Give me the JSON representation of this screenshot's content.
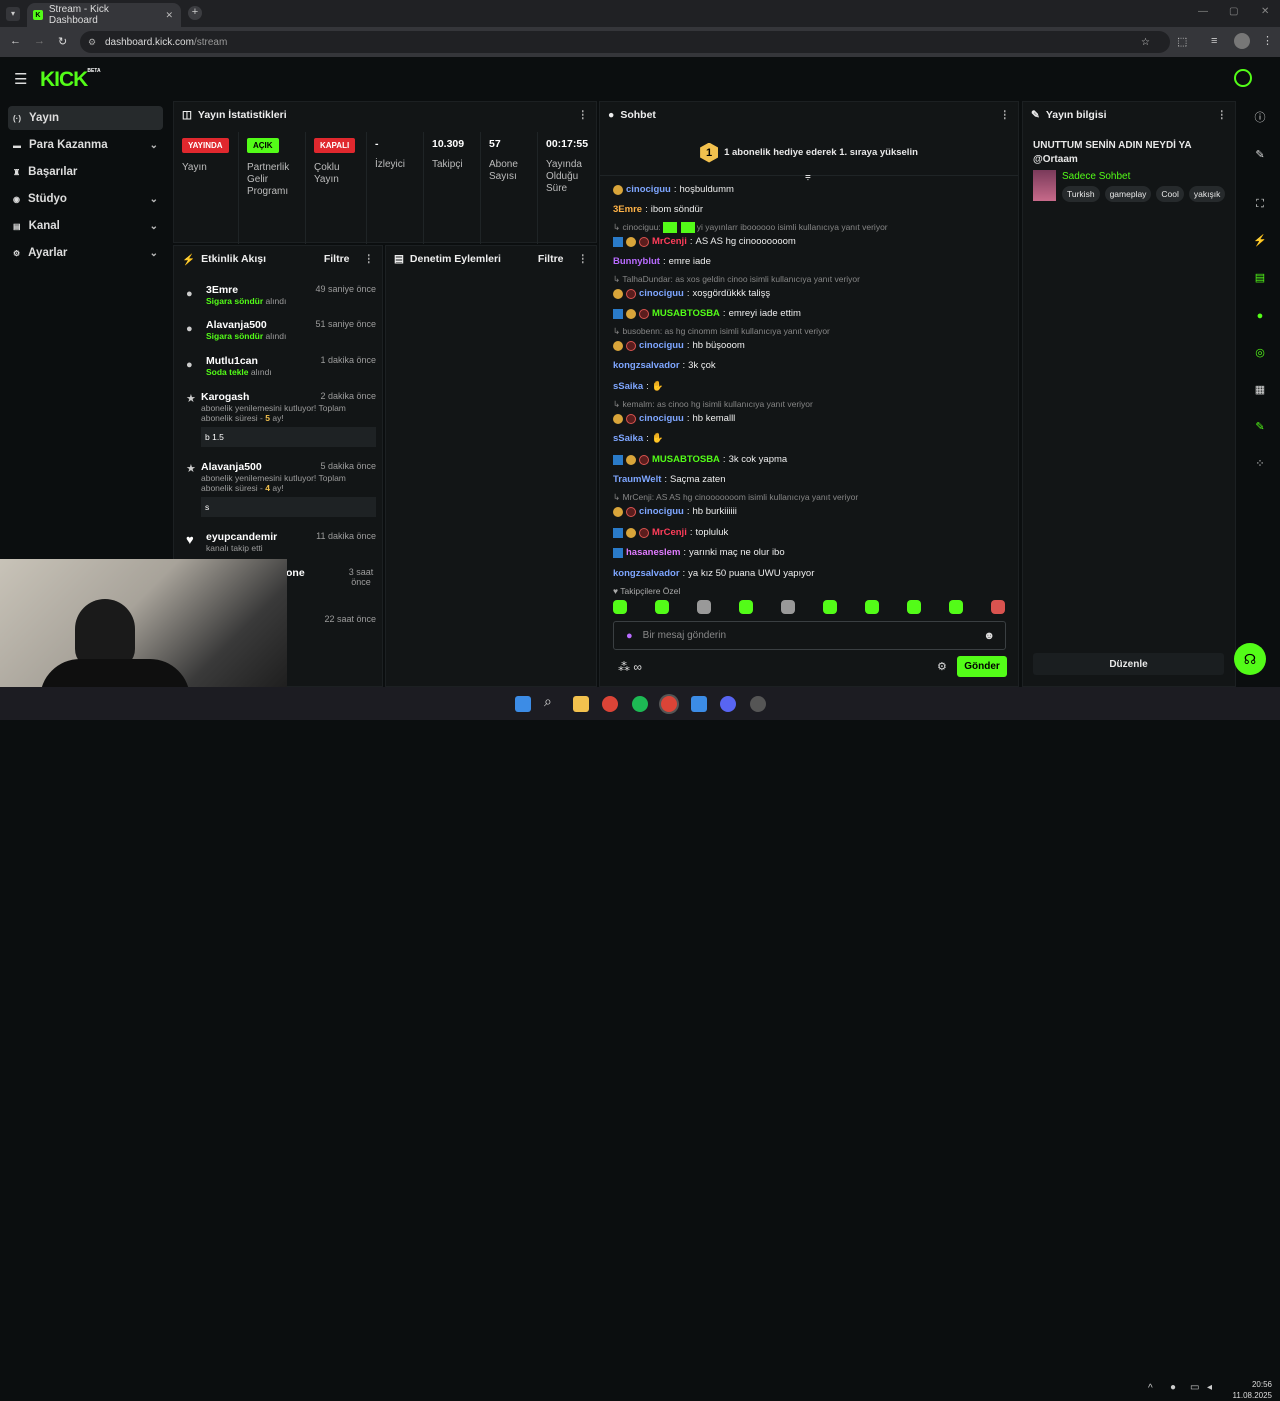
{
  "browser": {
    "tab_title": "Stream - Kick Dashboard",
    "url_domain": "dashboard.kick.com",
    "url_path": "/stream",
    "new_tab": "+",
    "close": "✕"
  },
  "header": {
    "logo": "KICK",
    "logo_badge": "BETA"
  },
  "sidebar": {
    "items": [
      {
        "label": "Yayın",
        "icon": "broadcast-icon",
        "glyph": "(·)",
        "active": true
      },
      {
        "label": "Para Kazanma",
        "icon": "money-icon",
        "glyph": "▬",
        "chevron": true
      },
      {
        "label": "Başarılar",
        "icon": "trophy-icon",
        "glyph": "♜"
      },
      {
        "label": "Stüdyo",
        "icon": "studio-icon",
        "glyph": "◉",
        "chevron": true
      },
      {
        "label": "Kanal",
        "icon": "channel-icon",
        "glyph": "▤",
        "chevron": true
      },
      {
        "label": "Ayarlar",
        "icon": "gear-icon",
        "glyph": "⚙",
        "chevron": true
      }
    ]
  },
  "stats": {
    "title": "Yayın İstatistikleri",
    "items": [
      {
        "pill": "YAYINDA",
        "pill_color": "#e0282e",
        "label": "Yayın"
      },
      {
        "pill": "AÇIK",
        "pill_color": "#53fc18",
        "label": "Partnerlik Gelir Programı"
      },
      {
        "pill": "KAPALI",
        "pill_color": "#e0282e",
        "label": "Çoklu Yayın"
      },
      {
        "value": "-",
        "label": "İzleyici"
      },
      {
        "value": "10.309",
        "label": "Takipçi"
      },
      {
        "value": "57",
        "label": "Abone Sayısı"
      },
      {
        "value": "00:17:55",
        "label": "Yayında Olduğu Süre"
      }
    ]
  },
  "activity": {
    "title": "Etkinlik Akışı",
    "filter": "Filtre",
    "events": [
      {
        "user": "3Emre",
        "time": "49 saniye önce",
        "item": "Sigara söndür",
        "suffix": "alındı"
      },
      {
        "user": "Alavanja500",
        "time": "51 saniye önce",
        "item": "Sigara söndür",
        "suffix": "alındı"
      },
      {
        "user": "Mutlu1can",
        "time": "1 dakika önce",
        "item": "Soda tekle",
        "suffix": "alındı"
      },
      {
        "user": "Karogash",
        "time": "2 dakika önce",
        "text": "abonelik yenilemesini kutluyor! Toplam abonelik süresi -",
        "months": "5",
        "unit": "ay!",
        "msg": "b 1.5"
      },
      {
        "user": "Alavanja500",
        "time": "5 dakika önce",
        "text": "abonelik yenilemesini kutluyor! Toplam abonelik süresi -",
        "months": "4",
        "unit": "ay!",
        "msg": "s"
      },
      {
        "user": "eyupcandemir",
        "time": "11 dakika önce",
        "text": "kanalı takip etti"
      },
      {
        "user": "one",
        "time": "3 saat önce"
      },
      {
        "time": "22 saat önce"
      }
    ]
  },
  "moderation": {
    "title": "Denetim Eylemleri",
    "filter": "Filtre"
  },
  "chat": {
    "title": "Sohbet",
    "banner": "1 abonelik hediye ederek 1. sıraya yükselin",
    "banner_num": "1",
    "lines": [
      {
        "type": "msg",
        "badges": [
          "b1"
        ],
        "user": "cinociguu",
        "color": "#7ea6ff",
        "text": "hoşbuldumm"
      },
      {
        "type": "msg",
        "user": "3Emre",
        "color": "#ffb347",
        "text": "ibom söndür"
      },
      {
        "type": "reply",
        "text": "cinociguu:",
        "tail": "yi yayınlarr iboooooo isimli kullanıcıya yanıt veriyor"
      },
      {
        "type": "msg",
        "badges": [
          "b3",
          "b1",
          "b2"
        ],
        "user": "MrCenji",
        "color": "#ff3d5a",
        "text": "AS AS hg cinooooooom"
      },
      {
        "type": "msg",
        "user": "Bunnyblut",
        "color": "#b96bff",
        "text": "emre iade"
      },
      {
        "type": "reply",
        "text": "TalhaDundar: as xos geldin cinoo isimli kullanıcıya yanıt veriyor"
      },
      {
        "type": "msg",
        "badges": [
          "b1",
          "b2"
        ],
        "user": "cinociguu",
        "color": "#7ea6ff",
        "text": "xoşgördükkk talişş"
      },
      {
        "type": "msg",
        "badges": [
          "b3",
          "b1",
          "b2"
        ],
        "user": "MUSABTOSBA",
        "color": "#53fc18",
        "text": "emreyi iade ettim"
      },
      {
        "type": "reply",
        "text": "busobenn: as hg cinomm isimli kullanıcıya yanıt veriyor"
      },
      {
        "type": "msg",
        "badges": [
          "b1",
          "b2"
        ],
        "user": "cinociguu",
        "color": "#7ea6ff",
        "text": "hb büşooom"
      },
      {
        "type": "msg",
        "user": "kongzsalvador",
        "color": "#7ea6ff",
        "text": "3k çok"
      },
      {
        "type": "msg",
        "user": "sSaika",
        "color": "#7ea6ff",
        "text": "✋"
      },
      {
        "type": "reply",
        "text": "kemalm: as cinoo hg isimli kullanıcıya yanıt veriyor"
      },
      {
        "type": "msg",
        "badges": [
          "b1",
          "b2"
        ],
        "user": "cinociguu",
        "color": "#7ea6ff",
        "text": "hb kemalll"
      },
      {
        "type": "msg",
        "user": "sSaika",
        "color": "#7ea6ff",
        "text": "✋"
      },
      {
        "type": "msg",
        "badges": [
          "b3",
          "b1",
          "b2"
        ],
        "user": "MUSABTOSBA",
        "color": "#53fc18",
        "text": "3k cok yapma"
      },
      {
        "type": "msg",
        "user": "TraumWelt",
        "color": "#7ea6ff",
        "text": "Saçma zaten"
      },
      {
        "type": "reply",
        "text": "MrCenji: AS AS hg cinooooooom isimli kullanıcıya yanıt veriyor"
      },
      {
        "type": "msg",
        "badges": [
          "b1",
          "b2"
        ],
        "user": "cinociguu",
        "color": "#7ea6ff",
        "text": "hb burkiiiiii"
      },
      {
        "type": "msg",
        "badges": [
          "b3",
          "b1",
          "b2"
        ],
        "user": "MrCenji",
        "color": "#ff3d5a",
        "text": "topluluk"
      },
      {
        "type": "msg",
        "badges": [
          "b3"
        ],
        "user": "hasaneslem",
        "color": "#e07bff",
        "text": "yarınki maç ne olur ibo"
      },
      {
        "type": "msg",
        "user": "kongzsalvador",
        "color": "#7ea6ff",
        "text": "ya kız 50 puana UWU yapıyor"
      }
    ],
    "followers_only": "Takipçilere Özel",
    "input_placeholder": "Bir mesaj gönderin",
    "send": "Gönder"
  },
  "stream_info": {
    "title": "Yayın bilgisi",
    "stream_title": "UNUTTUM SENİN ADIN NEYDİ YA @Ortaam",
    "category": "Sadece Sohbet",
    "tags": [
      "Turkish",
      "gameplay",
      "Cool",
      "yakışık"
    ],
    "edit": "Düzenle"
  },
  "taskbar": {
    "time": "20:56",
    "date": "11.08.2025"
  }
}
